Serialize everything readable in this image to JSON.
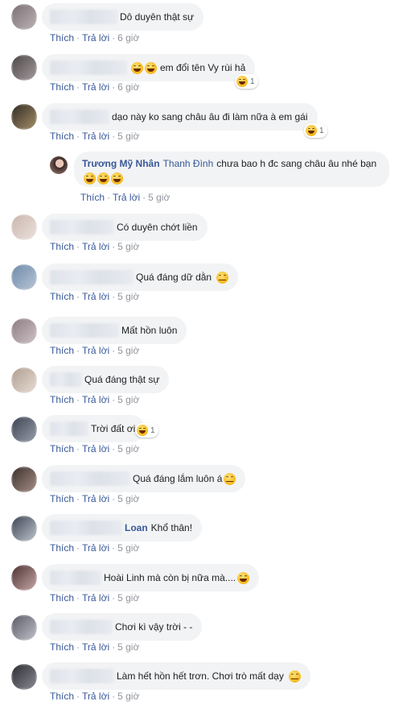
{
  "actions": {
    "like": "Thích",
    "reply": "Trả lời",
    "sep": "·"
  },
  "comments": [
    {
      "text": "Dô duyên thật sự",
      "time": "6 giờ"
    },
    {
      "text": "em đổi tên Vy rùi hả",
      "time": "6 giờ",
      "reaction_count": "1"
    },
    {
      "text": "dạo này ko sang châu âu đi làm nữa à em gái",
      "time": "5 giờ",
      "reaction_count": "1"
    },
    {
      "name": "Trương Mỹ Nhân",
      "mention": "Thanh Đình",
      "text": "chưa bao h đc sang châu âu nhé bạn",
      "time": "5 giờ"
    },
    {
      "text": "Có duyên chớt liền",
      "time": "5 giờ"
    },
    {
      "text": "Quá đáng dữ dằn",
      "time": "5 giờ"
    },
    {
      "text": "Mất hồn luôn",
      "time": "5 giờ"
    },
    {
      "text": "Quá đáng thật sự",
      "time": "5 giờ"
    },
    {
      "text": "Trời đất ơi",
      "time": "5 giờ",
      "reaction_count": "1"
    },
    {
      "text": "Quá đáng lắm luôn á",
      "time": "5 giờ"
    },
    {
      "mention": "Loan",
      "text": "Khổ thân!",
      "time": "5 giờ"
    },
    {
      "text": "Hoài Linh mà còn bị nữa mà....",
      "time": "5 giờ"
    },
    {
      "text": "Chơi kì vậy trời - -",
      "time": "5 giờ"
    },
    {
      "text": "Làm hết hồn hết trơn. Chơi trò mất dạy",
      "time": "5 giờ"
    }
  ]
}
